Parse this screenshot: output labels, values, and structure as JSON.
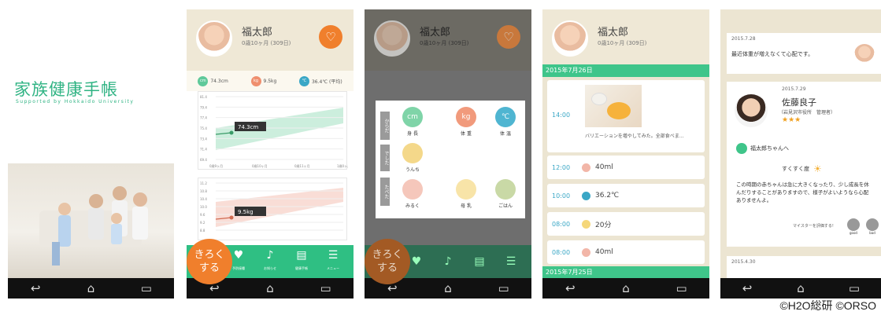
{
  "screen1": {
    "title": "家族健康手帳",
    "subtitle": "Supported by Hokkaido University"
  },
  "profile": {
    "name": "福太郎",
    "age": "0歳10ヶ月 (309日)"
  },
  "stats": {
    "height": "74.3cm",
    "weight": "9.5kg",
    "temp": "36.4℃ (平均)",
    "height_icon": "cm",
    "weight_icon": "kg",
    "temp_icon": "℃"
  },
  "chart_data": [
    {
      "type": "line",
      "series": [
        {
          "values": [
            74.3
          ]
        }
      ],
      "data_label": "74.3cm",
      "yticks": [
        "81.4",
        "79.4",
        "77.4",
        "75.4",
        "73.4",
        "71.4",
        "69.4"
      ],
      "xticks": [
        "0歳9ヶ月",
        "0歳10ヶ月",
        "0歳11ヶ月",
        "1歳0ヶ月"
      ]
    },
    {
      "type": "line",
      "series": [
        {
          "values": [
            9.5
          ]
        }
      ],
      "data_label": "9.5kg",
      "yticks": [
        "11.2",
        "10.8",
        "10.4",
        "10.0",
        "9.6",
        "9.2",
        "8.8"
      ]
    }
  ],
  "bottom_bar": {
    "kiroku": "きろく\nする",
    "items": [
      "予防接種",
      "お知らせ",
      "健康手帳",
      "メニュー"
    ]
  },
  "menu": {
    "groups": [
      "からだ",
      "でした",
      "たべた"
    ],
    "items": [
      {
        "icon": "cm",
        "label": "身 長"
      },
      {
        "icon": "kg",
        "label": "体 重"
      },
      {
        "icon": "℃",
        "label": "体 温"
      },
      {
        "icon": "",
        "label": "うんち"
      },
      {
        "icon": "",
        "label": "みるく"
      },
      {
        "icon": "",
        "label": "母 乳"
      },
      {
        "icon": "",
        "label": "ごはん"
      }
    ]
  },
  "timeline": {
    "date1": "2015年7月26日",
    "photo_time": "14:00",
    "photo_caption": "バリエーションを増やしてみた。全部食べま…",
    "entries": [
      {
        "time": "12:00",
        "value": "40ml",
        "color": "#f2b6a8"
      },
      {
        "time": "10:00",
        "value": "36.2℃",
        "color": "#3aa7c6"
      },
      {
        "time": "08:00",
        "value": "20分",
        "color": "#f5d77a"
      },
      {
        "time": "08:00",
        "value": "40ml",
        "color": "#f2b6a8"
      }
    ],
    "date2": "2015年7月25日"
  },
  "advice": {
    "q_date": "2015.7.28",
    "question": "最近体重が増えなくて心配です。",
    "a_date": "2015.7.29",
    "advisor_name": "佐藤良子",
    "advisor_role": "（岩見沢市役所　管理者）",
    "stars": "★★★",
    "to": "福太郎ちゃんへ",
    "growing": "すくすく度",
    "body": "この時期の赤ちゃんは急に大きくなったり、少し成長を休んだりすることがありますので、様子がよいようなら心配ありませんよ。",
    "rate_prompt": "マイスターを評価する!",
    "good": "good",
    "bad": "bad",
    "next_date": "2015.4.30"
  },
  "copyright": "©H2O総研 ©ORSO"
}
